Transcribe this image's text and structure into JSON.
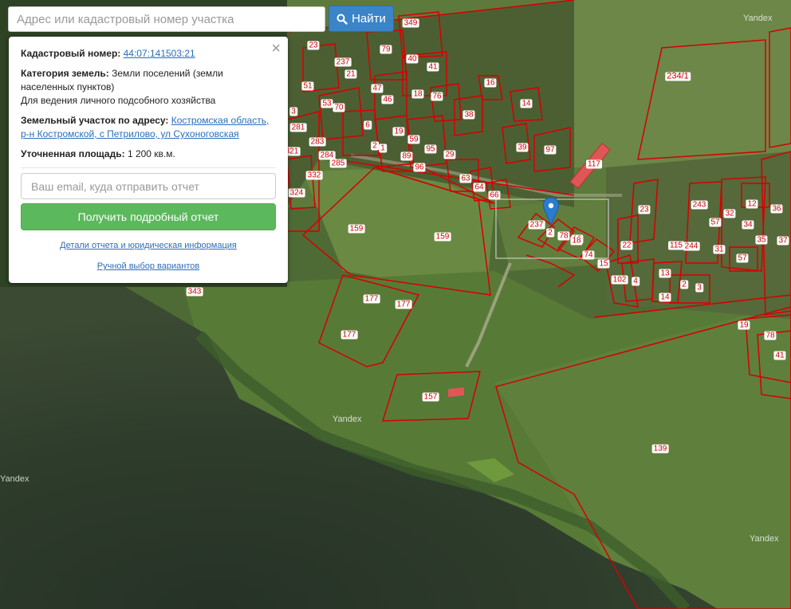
{
  "search": {
    "placeholder": "Адрес или кадастровый номер участка",
    "button_label": "Найти"
  },
  "panel": {
    "cadastral_label": "Кадастровый номер:",
    "cadastral_value": "44:07:141503:21",
    "category_label": "Категория земель:",
    "category_value": "Земли поселений (земли населенных пунктов)",
    "usage_value": "Для ведения личного подсобного хозяйства",
    "address_label": "Земельный участок по адресу:",
    "address_line1": "Костромская область,",
    "address_line2": "р-н Костромской, с Петрилово, ул Сухоноговская",
    "area_label": "Уточненная площадь:",
    "area_value": "1 200 кв.м.",
    "email_placeholder": "Ваш email, куда отправить отчет",
    "report_button": "Получить подробный отчет",
    "details_link": "Детали отчета и юридическая информация",
    "manual_link": "Ручной выбор вариантов",
    "close_icon": "close-icon"
  },
  "map": {
    "watermark": "Yandex",
    "marker_icon": "map-pin-icon",
    "plot_labels": [
      "349",
      "79",
      "40",
      "41",
      "23",
      "237",
      "21",
      "51",
      "47",
      "46",
      "18",
      "76",
      "53",
      "70",
      "16",
      "14",
      "6",
      "19",
      "38",
      "59",
      "2",
      "95",
      "29",
      "1",
      "89",
      "96",
      "3",
      "281",
      "283",
      "284",
      "285",
      "321",
      "332",
      "324",
      "343",
      "63",
      "64",
      "66",
      "39",
      "97",
      "234/1",
      "159",
      "159",
      "237",
      "2",
      "78",
      "18",
      "74",
      "15",
      "102",
      "4",
      "13",
      "14",
      "2",
      "3",
      "22",
      "23",
      "177",
      "177",
      "177",
      "157",
      "139",
      "19",
      "78",
      "115",
      "244",
      "31",
      "57",
      "57",
      "243",
      "32",
      "12",
      "34",
      "35",
      "37",
      "36",
      "41",
      "18",
      "117"
    ]
  }
}
